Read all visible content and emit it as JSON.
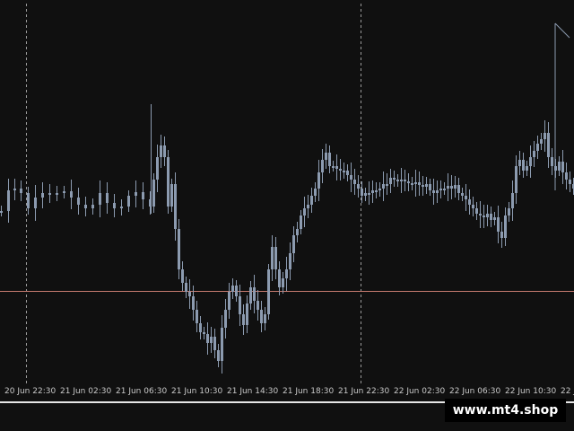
{
  "chart": {
    "background": "#101010",
    "candle_color": "#8c9bb0",
    "price_line_color": "#c47a6e",
    "grid_line_color": "#9a9a9a",
    "time_axis_labels": [
      "20 Jun 22:30",
      "21 Jun 02:30",
      "21 Jun 06:30",
      "21 Jun 10:30",
      "21 Jun 14:30",
      "21 Jun 18:30",
      "21 Jun 22:30",
      "22 Jun 02:30",
      "22 Jun 06:30",
      "22 Jun 10:30",
      "22 Ju"
    ]
  },
  "watermark": {
    "text": "www.mt4.shop"
  }
}
